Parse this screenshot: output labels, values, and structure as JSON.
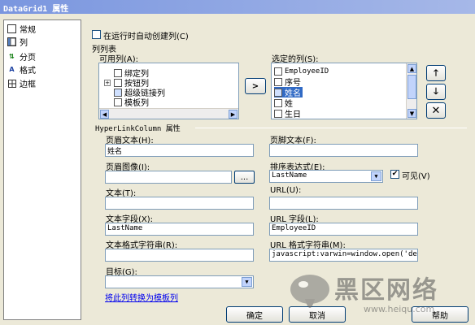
{
  "window": {
    "title": "DataGrid1 属性"
  },
  "nav": [
    {
      "label": "常规",
      "icon": "general-icon"
    },
    {
      "label": "列",
      "icon": "columns-icon"
    },
    {
      "label": "分页",
      "icon": "paging-icon"
    },
    {
      "label": "格式",
      "icon": "format-icon"
    },
    {
      "label": "边框",
      "icon": "border-icon"
    }
  ],
  "auto_columns": {
    "label": "在运行时自动创建列(C)",
    "checked": false
  },
  "column_list": {
    "label": "列列表",
    "available_label": "可用列(A):",
    "available_items": [
      "绑定列",
      "按钮列",
      "超级链接列",
      "模板列"
    ],
    "selected_label": "选定的列(S):",
    "selected_items": [
      "EmployeeID",
      "序号",
      "姓名",
      "姓",
      "生日"
    ],
    "add_glyph": ">"
  },
  "properties": {
    "group_label": "HyperLinkColumn 属性",
    "header_text_label": "页眉文本(H):",
    "header_text_value": "姓名",
    "footer_text_label": "页脚文本(F):",
    "footer_text_value": "",
    "header_image_label": "页眉图像(I):",
    "header_image_value": "",
    "browse_label": "...",
    "sort_label": "排序表达式(E):",
    "sort_value": "LastName",
    "visible_label": "可见(V)",
    "visible_checked": true,
    "text_label": "文本(T):",
    "text_value": "",
    "url_label": "URL(U):",
    "url_value": "",
    "text_field_label": "文本字段(X):",
    "text_field_value": "LastName",
    "url_field_label": "URL 字段(L):",
    "url_field_value": "EmployeeID",
    "text_format_label": "文本格式字符串(R):",
    "text_format_value": "",
    "url_format_label": "URL 格式字符串(M):",
    "url_format_value": "javascript:varwin=window.open('detail.",
    "target_label": "目标(G):",
    "target_value": "",
    "convert_link": "将此列转换为模板列"
  },
  "footer": {
    "ok": "确定",
    "cancel": "取消",
    "help": "帮助"
  },
  "watermark": {
    "text": "黑区网络",
    "url": "www.heiqu.com"
  }
}
